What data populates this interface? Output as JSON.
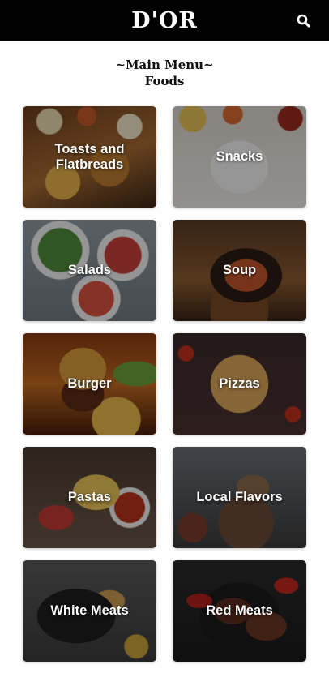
{
  "header": {
    "brand": "D'OR",
    "search_icon": "search-icon"
  },
  "menu": {
    "title": "~Main Menu~",
    "subtitle": "Foods"
  },
  "categories": [
    {
      "label": "Toasts and Flatbreads"
    },
    {
      "label": "Snacks"
    },
    {
      "label": "Salads"
    },
    {
      "label": "Soup"
    },
    {
      "label": "Burger"
    },
    {
      "label": "Pizzas"
    },
    {
      "label": "Pastas"
    },
    {
      "label": "Local Flavors"
    },
    {
      "label": "White Meats"
    },
    {
      "label": "Red Meats"
    }
  ],
  "colors": {
    "header_bg": "#000000",
    "brand_text": "#ffffff",
    "page_bg": "#ffffff"
  }
}
